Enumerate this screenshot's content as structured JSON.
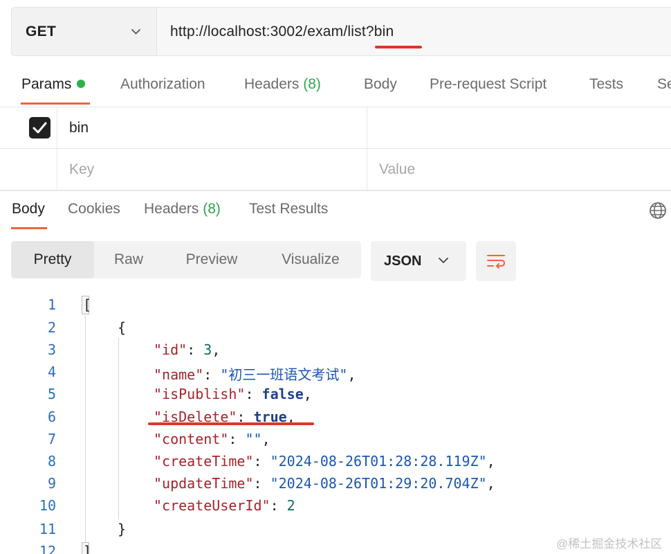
{
  "request": {
    "method": "GET",
    "url": "http://localhost:3002/exam/list?bin"
  },
  "request_tabs": {
    "params": "Params",
    "authorization": "Authorization",
    "headers": "Headers",
    "headers_count": "(8)",
    "body": "Body",
    "prerequest": "Pre-request Script",
    "tests": "Tests",
    "settings_partial": "Se"
  },
  "params_table": {
    "rows": [
      {
        "checked": true,
        "key": "bin",
        "value": ""
      }
    ],
    "key_placeholder": "Key",
    "value_placeholder": "Value"
  },
  "response_tabs": {
    "body": "Body",
    "cookies": "Cookies",
    "headers": "Headers",
    "headers_count": "(8)",
    "test_results": "Test Results"
  },
  "view_modes": {
    "pretty": "Pretty",
    "raw": "Raw",
    "preview": "Preview",
    "visualize": "Visualize",
    "selected": "Pretty"
  },
  "format": {
    "selected": "JSON"
  },
  "code": {
    "line_numbers": [
      "1",
      "2",
      "3",
      "4",
      "5",
      "6",
      "7",
      "8",
      "9",
      "10",
      "11",
      "12"
    ],
    "open_bracket": "[",
    "open_brace": "{",
    "close_brace": "}",
    "close_bracket": "]",
    "fields": [
      {
        "key": "\"id\"",
        "sep": ": ",
        "value": "3",
        "type": "num",
        "trail": ","
      },
      {
        "key": "\"name\"",
        "sep": ": ",
        "value": "\"初三一班语文考试\"",
        "type": "str",
        "trail": ","
      },
      {
        "key": "\"isPublish\"",
        "sep": ": ",
        "value": "false",
        "type": "kw",
        "trail": ","
      },
      {
        "key": "\"isDelete\"",
        "sep": ": ",
        "value": "true",
        "type": "kw",
        "trail": ","
      },
      {
        "key": "\"content\"",
        "sep": ": ",
        "value": "\"\"",
        "type": "str",
        "trail": ","
      },
      {
        "key": "\"createTime\"",
        "sep": ": ",
        "value": "\"2024-08-26T01:28:28.119Z\"",
        "type": "str",
        "trail": ","
      },
      {
        "key": "\"updateTime\"",
        "sep": ": ",
        "value": "\"2024-08-26T01:29:20.704Z\"",
        "type": "str",
        "trail": ","
      },
      {
        "key": "\"createUserId\"",
        "sep": ": ",
        "value": "2",
        "type": "num",
        "trail": ""
      }
    ]
  },
  "watermark": "@稀土掘金技术社区",
  "colors": {
    "accent_underline": "#f0643c",
    "annotation_red": "#e0342a",
    "status_green": "#2bb24c"
  }
}
